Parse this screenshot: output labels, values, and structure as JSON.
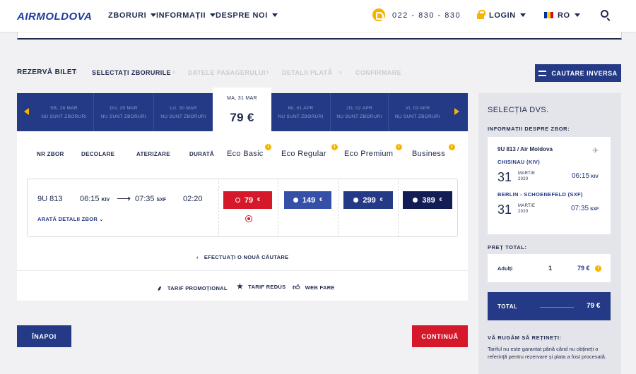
{
  "header": {
    "logo": "AIRMOLDOVA",
    "nav": [
      "ZBORURI",
      "INFORMAȚII",
      "DESPRE NOI"
    ],
    "phone": "022 - 830 - 830",
    "login": "LOGIN",
    "language": "RO",
    "flag_colors": [
      "#0033a0",
      "#ffd200",
      "#cc092f"
    ]
  },
  "steps": [
    "REZERVĂ BILET",
    "SELECTAȚI ZBORURILE",
    "DATELE PASAGERULUI",
    "DETALII PLATĂ",
    "CONFIRMARE"
  ],
  "reverse_button": "CAUTARE INVERSA",
  "dates": [
    {
      "label": "SB, 28 MAR",
      "status": "NU SUNT ZBORURI"
    },
    {
      "label": "DU, 29 MAR",
      "status": "NU SUNT ZBORURI"
    },
    {
      "label": "LU, 30 MAR",
      "status": "NU SUNT ZBORURI"
    },
    {
      "label": "MA, 31 MAR",
      "price": "79 €"
    },
    {
      "label": "MI, 01 APR",
      "status": "NU SUNT ZBORURI"
    },
    {
      "label": "JO, 02 APR",
      "status": "NU SUNT ZBORURI"
    },
    {
      "label": "VI, 03 APR",
      "status": "NU SUNT ZBORURI"
    }
  ],
  "columns": [
    "NR ZBOR",
    "DECOLARE",
    "ATERIZARE",
    "DURATĂ"
  ],
  "fare_classes": [
    "Eco Basic",
    "Eco Regular",
    "Eco Premium",
    "Business"
  ],
  "flight": {
    "number": "9U 813",
    "dep_time": "06:15",
    "dep_code": "KIV",
    "arr_time": "07:35",
    "arr_code": "SXF",
    "duration": "02:20",
    "details_link": "ARATĂ DETALII ZBOR"
  },
  "fares": [
    {
      "price": "79",
      "currency": "€",
      "color": "#d6182b"
    },
    {
      "price": "149",
      "currency": "€",
      "color": "#3550a7"
    },
    {
      "price": "299",
      "currency": "€",
      "color": "#253a86"
    },
    {
      "price": "389",
      "currency": "€",
      "color": "#121c55"
    }
  ],
  "new_search": "EFECTUAȚI O NOUĂ CĂUTARE",
  "legend": [
    {
      "icon": "promo-icon",
      "label": "TARIF PROMOȚIONAL"
    },
    {
      "icon": "star-icon",
      "label": "TARIF REDUS"
    },
    {
      "icon": "thumbs-up-icon",
      "label": "WEB FARE"
    }
  ],
  "buttons": {
    "back": "ÎNAPOI",
    "next": "CONTINUĂ"
  },
  "sidebar": {
    "title": "SELECȚIA DVS.",
    "info_label": "INFORMAȚII DESPRE ZBOR:",
    "flight": "9U 813 / Air Moldova",
    "from": "CHISINAU (KIV)",
    "from_day": "31",
    "from_month": "MARTIE",
    "from_year": "2020",
    "from_time": "06:15",
    "from_code": "KIV",
    "to": "BERLIN - SCHOENEFELD (SXF)",
    "to_day": "31",
    "to_month": "MARTIE",
    "to_year": "2020",
    "to_time": "07:35",
    "to_code": "SXF",
    "price_label": "PREȚ TOTAL:",
    "adults_label": "Adulți",
    "adults_count": "1",
    "adults_price": "79 €",
    "total_label": "TOTAL",
    "total_value": "79 €",
    "note_title": "VĂ RUGĂM SĂ REȚINEȚI:",
    "note_text": "Tariful nu este garantat până când nu obțineți o referință pentru rezervare și plata a fost procesată."
  }
}
